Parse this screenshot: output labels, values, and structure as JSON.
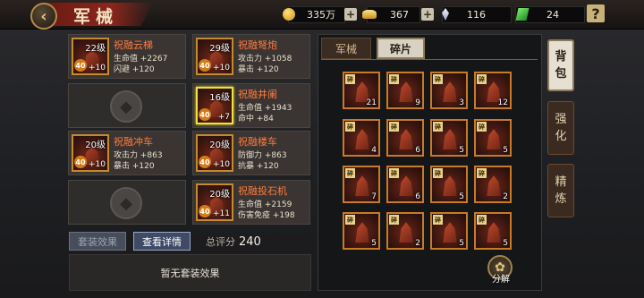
{
  "header": {
    "back_icon": "back-arrow-icon",
    "title": "军械",
    "gold": "335万",
    "ingot": "367",
    "crystal": "116",
    "jade": "24",
    "help": "?"
  },
  "equipment": [
    {
      "name": "祝融云梯",
      "level": "22级",
      "star": "40",
      "plus": "+10",
      "stats": [
        "生命值 +2267",
        "闪避 +120"
      ],
      "selected": false
    },
    {
      "name": "祝融弩炮",
      "level": "29级",
      "star": "40",
      "plus": "+10",
      "stats": [
        "攻击力 +1058",
        "暴击 +120"
      ],
      "selected": false
    },
    {
      "empty": true,
      "icon": "empty-slot-icon"
    },
    {
      "name": "祝融井阑",
      "level": "16级",
      "star": "40",
      "plus": "+7",
      "stats": [
        "生命值 +1943",
        "命中 +84"
      ],
      "selected": true
    },
    {
      "name": "祝融冲车",
      "level": "20级",
      "star": "40",
      "plus": "+10",
      "stats": [
        "攻击力 +863",
        "暴击 +120"
      ],
      "selected": false
    },
    {
      "name": "祝融楼车",
      "level": "20级",
      "star": "40",
      "plus": "+10",
      "stats": [
        "防御力 +863",
        "抗暴 +120"
      ],
      "selected": false
    },
    {
      "empty": true,
      "icon": "empty-slot-icon"
    },
    {
      "name": "祝融投石机",
      "level": "20级",
      "star": "40",
      "plus": "+11",
      "stats": [
        "生命值 +2159",
        "伤害免疫 +198"
      ],
      "selected": false
    }
  ],
  "buttons": {
    "set_effect": "套装效果",
    "view_details": "查看详情",
    "score_label": "总评分",
    "score_value": "240",
    "no_set_effect": "暂无套装效果",
    "decompose": "分解"
  },
  "inventory": {
    "tabs": [
      "军械",
      "碎片"
    ],
    "active_tab": "碎片",
    "fragment_badge": "碎",
    "counts": [
      "21",
      "9",
      "3",
      "12",
      "4",
      "6",
      "5",
      "5",
      "7",
      "6",
      "5",
      "2",
      "5",
      "2",
      "5",
      "5"
    ]
  },
  "side_tabs": [
    {
      "label": "背包",
      "active": true
    },
    {
      "label": "强化",
      "active": false
    },
    {
      "label": "精炼",
      "active": false
    }
  ],
  "colors": {
    "item_name": "#ff7a3e",
    "selected_border": "#f3e03a",
    "item_border": "#c58a2c"
  }
}
